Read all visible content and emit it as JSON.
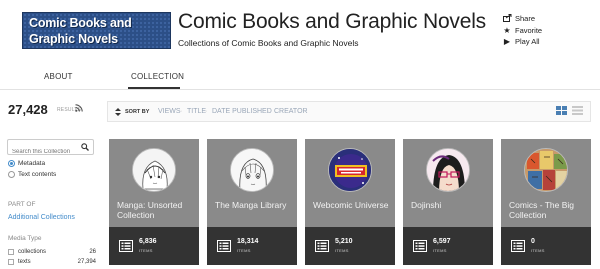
{
  "header": {
    "banner_line1": "Comic Books and",
    "banner_line2": "Graphic Novels",
    "title": "Comic Books and Graphic Novels",
    "subtitle": "Collections of Comic Books and Graphic Novels",
    "actions": [
      {
        "label": "Share",
        "icon": "share-icon"
      },
      {
        "label": "Favorite",
        "icon": "star-icon"
      },
      {
        "label": "Play All",
        "icon": "play-icon"
      }
    ]
  },
  "tabs": {
    "about": "ABOUT",
    "collection": "COLLECTION",
    "active": "collection"
  },
  "results": {
    "count": "27,428",
    "label": "RESULTS"
  },
  "search": {
    "placeholder": "Search this Collection",
    "options": [
      {
        "label": "Metadata",
        "selected": true
      },
      {
        "label": "Text contents",
        "selected": false
      }
    ]
  },
  "part_of": {
    "label": "PART OF",
    "link": "Additional Collections"
  },
  "media_type": {
    "label": "Media Type",
    "facets": [
      {
        "label": "collections",
        "count": "26"
      },
      {
        "label": "texts",
        "count": "27,394"
      }
    ]
  },
  "sort": {
    "label": "SORT BY",
    "options": [
      "VIEWS",
      "TITLE",
      "DATE PUBLISHED",
      "CREATOR"
    ]
  },
  "cards": [
    {
      "title": "Manga: Unsorted Collection",
      "count": "6,836",
      "unit": "ITEMS"
    },
    {
      "title": "The Manga Library",
      "count": "18,314",
      "unit": "ITEMS"
    },
    {
      "title": "Webcomic Universe",
      "count": "5,210",
      "unit": "ITEMS"
    },
    {
      "title": "Dojinshi",
      "count": "6,597",
      "unit": "ITEMS"
    },
    {
      "title": "Comics - The Big Collection",
      "count": "0",
      "unit": "ITEMS"
    }
  ],
  "colors": {
    "accent_link": "#428bca",
    "card_bg": "#8a8a8a",
    "card_footer": "#333333",
    "banner_bg": "#2c4f87"
  }
}
